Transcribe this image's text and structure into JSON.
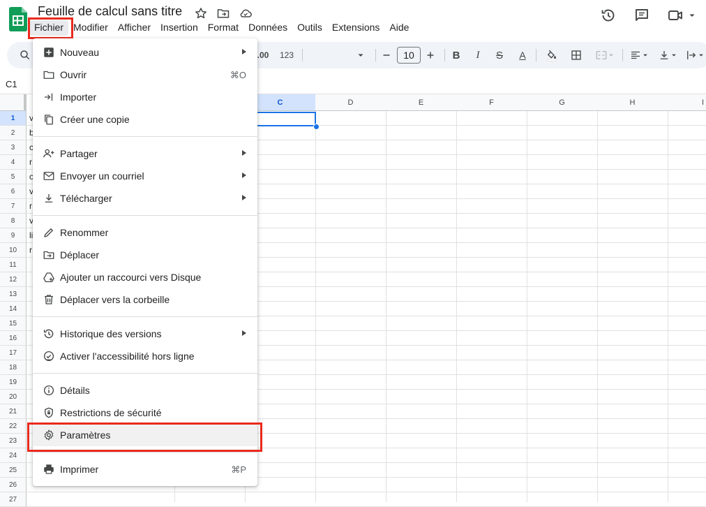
{
  "header": {
    "doc_title": "Feuille de calcul sans titre",
    "menu": [
      {
        "label": "Fichier",
        "active": true
      },
      {
        "label": "Modifier"
      },
      {
        "label": "Afficher"
      },
      {
        "label": "Insertion"
      },
      {
        "label": "Format"
      },
      {
        "label": "Données"
      },
      {
        "label": "Outils"
      },
      {
        "label": "Extensions"
      },
      {
        "label": "Aide"
      }
    ],
    "icons": [
      "star-icon",
      "move-folder-icon",
      "cloud-status-icon",
      "history-icon",
      "comment-icon",
      "video-call-icon"
    ]
  },
  "toolbar": {
    "decimal_label": ".00",
    "number_format_label": "123",
    "font_size": "10",
    "text_color_letter": "A",
    "bold_label": "B",
    "italic_label": "I",
    "strike_label": "S"
  },
  "formula_bar": {
    "name_box": "C1"
  },
  "grid": {
    "columns": [
      "C",
      "D",
      "E",
      "F",
      "G",
      "H",
      "I"
    ],
    "selected_column": "C",
    "rows": [
      "1",
      "2",
      "3",
      "4",
      "5",
      "6",
      "7",
      "8",
      "9",
      "10",
      "11",
      "12",
      "13",
      "14",
      "15",
      "16",
      "17",
      "18",
      "19",
      "20",
      "21",
      "22",
      "23",
      "24",
      "25",
      "26",
      "27"
    ],
    "selected_row": "1",
    "col_a_partial": [
      "v",
      "b",
      "c",
      "r",
      "c",
      "v",
      "r",
      "v",
      "li",
      "r"
    ]
  },
  "file_menu": {
    "items": [
      {
        "label": "Nouveau",
        "icon": "new-sheet-icon",
        "submenu": true
      },
      {
        "label": "Ouvrir",
        "icon": "open-folder-icon",
        "shortcut": "⌘O"
      },
      {
        "label": "Importer",
        "icon": "import-icon"
      },
      {
        "label": "Créer une copie",
        "icon": "copy-icon"
      },
      {
        "label": "Partager",
        "icon": "share-person-icon",
        "submenu": true
      },
      {
        "label": "Envoyer un courriel",
        "icon": "email-icon",
        "submenu": true
      },
      {
        "label": "Télécharger",
        "icon": "download-icon",
        "submenu": true
      },
      {
        "label": "Renommer",
        "icon": "pencil-icon"
      },
      {
        "label": "Déplacer",
        "icon": "move-folder-icon"
      },
      {
        "label": "Ajouter un raccourci vers Disque",
        "icon": "drive-shortcut-icon"
      },
      {
        "label": "Déplacer vers la corbeille",
        "icon": "trash-icon"
      },
      {
        "label": "Historique des versions",
        "icon": "history-icon",
        "submenu": true
      },
      {
        "label": "Activer l'accessibilité hors ligne",
        "icon": "offline-check-icon"
      },
      {
        "label": "Détails",
        "icon": "info-icon"
      },
      {
        "label": "Restrictions de sécurité",
        "icon": "shield-lock-icon"
      },
      {
        "label": "Paramètres",
        "icon": "gear-icon",
        "highlighted": true
      },
      {
        "label": "Imprimer",
        "icon": "printer-icon",
        "shortcut": "⌘P"
      }
    ]
  },
  "colors": {
    "accent": "#1a73e8",
    "highlight_box": "#ea2a1d",
    "sheets_green": "#0f9d58",
    "toolbar_bg": "#f0f4f9"
  }
}
